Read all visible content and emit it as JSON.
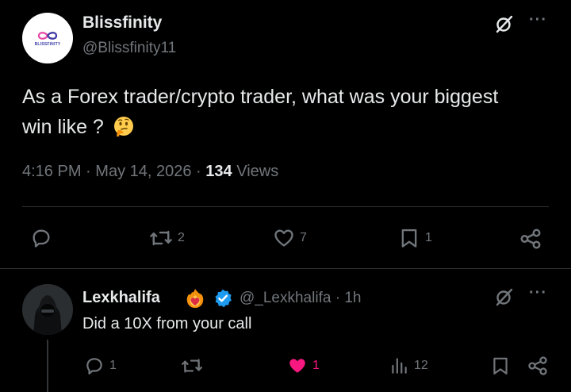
{
  "colors": {
    "background": "#000000",
    "text_primary": "#e7e9ea",
    "text_secondary": "#71767b",
    "divider": "#2f3336",
    "like_active": "#f91880",
    "verified_blue": "#1d9bf0"
  },
  "main_tweet": {
    "author_name": "Blissfinity",
    "author_handle": "@Blissfinity11",
    "avatar_logo_text": "BLISSFINITY",
    "text": "As a Forex trader/crypto trader, what was your biggest win like ?",
    "emoji": "thinking-face",
    "time": "4:16 PM",
    "date": "May 14, 2026",
    "separator": "·",
    "views_count": "134",
    "views_label": "Views",
    "more_label": "···",
    "actions": {
      "reply_count": "",
      "retweet_count": "2",
      "like_count": "7",
      "bookmark_count": "1"
    },
    "icons": [
      "grok-icon",
      "more-icon",
      "reply-icon",
      "retweet-icon",
      "like-icon",
      "bookmark-icon",
      "share-icon"
    ]
  },
  "reply": {
    "author_name": "Lexkhalifa",
    "badges": [
      "fire-heart-emoji",
      "verified-badge"
    ],
    "author_handle": "@_Lexkhalifa",
    "time_sep": "·",
    "time": "1h",
    "text": "Did a 10X from your call",
    "more_label": "···",
    "actions": {
      "reply_count": "1",
      "retweet_count": "",
      "like_count": "1",
      "like_active": true,
      "views_count": "12"
    }
  }
}
